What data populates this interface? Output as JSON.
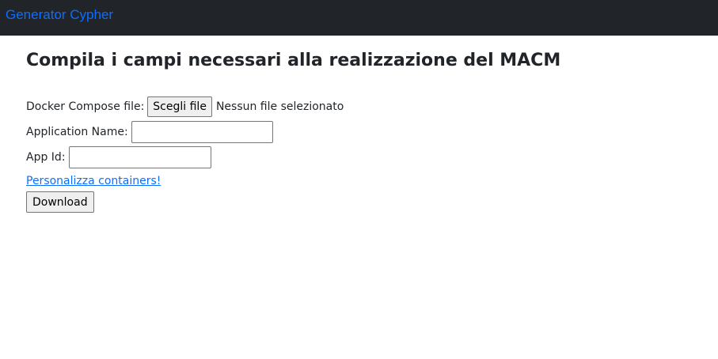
{
  "navbar": {
    "brand": "Generator Cypher"
  },
  "main": {
    "title": "Compila i campi necessari alla realizzazione del MACM",
    "docker_compose": {
      "label": "Docker Compose file:",
      "button_label": "Scegli file",
      "status": "Nessun file selezionato"
    },
    "application_name": {
      "label": "Application Name:",
      "value": ""
    },
    "app_id": {
      "label": "App Id:",
      "value": ""
    },
    "customize_link": "Personalizza containers!",
    "download_label": "Download"
  },
  "colors": {
    "navbar_bg": "#212529",
    "brand": "#0d6efd",
    "link": "#0d6efd"
  }
}
